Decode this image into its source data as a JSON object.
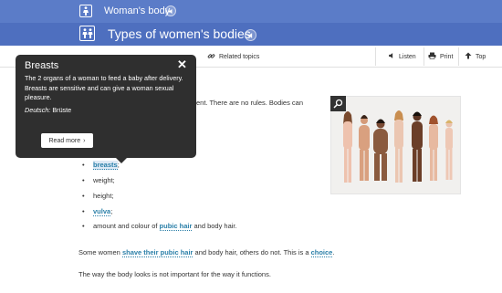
{
  "header": {
    "section_title": "Woman's body",
    "page_title": "Types of women's bodies"
  },
  "toolbar": {
    "related": "Related topics",
    "listen": "Listen",
    "print": "Print",
    "top": "Top"
  },
  "content": {
    "intro_visible": "ent. There are no rules. Bodies can",
    "bullets": [
      {
        "text": "breasts",
        "suffix": ";",
        "link": true
      },
      {
        "text": "weight;",
        "suffix": "",
        "link": false
      },
      {
        "text": "height;",
        "suffix": "",
        "link": false
      },
      {
        "text": "vulva",
        "suffix": ";",
        "link": true
      }
    ],
    "bullet5": {
      "pre": "amount and colour of ",
      "link": "pubic hair",
      "post": " and body hair."
    },
    "para1": {
      "pre": "Some women ",
      "link1": "shave their pubic hair",
      "mid": " and body hair, others do not. This is a ",
      "link2": "choice",
      "post": "."
    },
    "para2": "The way the body looks is not important for the way it functions."
  },
  "popup": {
    "title": "Breasts",
    "close": "✕",
    "body": "The 2 organs of a woman to feed a baby after delivery. Breasts are sensitive and can give a woman sexual pleasure.",
    "german_label": "Deutsch:",
    "german_value": "Brüste",
    "button": "Read more"
  },
  "colors": {
    "topbar": "#5b7cc8",
    "secondbar": "#4e6fbf",
    "link": "#2a7fa8",
    "popup_bg": "#2f2f2f"
  }
}
